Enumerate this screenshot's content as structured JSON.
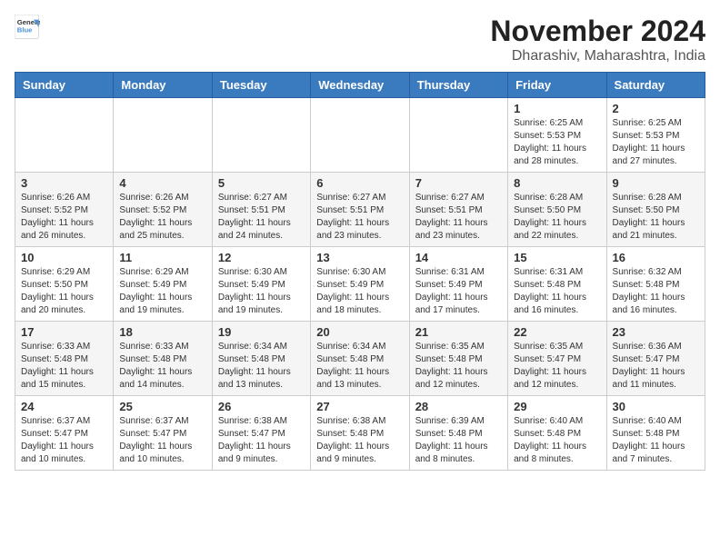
{
  "logo": {
    "line1": "General",
    "line2": "Blue"
  },
  "title": "November 2024",
  "subtitle": "Dharashiv, Maharashtra, India",
  "weekdays": [
    "Sunday",
    "Monday",
    "Tuesday",
    "Wednesday",
    "Thursday",
    "Friday",
    "Saturday"
  ],
  "weeks": [
    [
      {
        "day": "",
        "info": ""
      },
      {
        "day": "",
        "info": ""
      },
      {
        "day": "",
        "info": ""
      },
      {
        "day": "",
        "info": ""
      },
      {
        "day": "",
        "info": ""
      },
      {
        "day": "1",
        "info": "Sunrise: 6:25 AM\nSunset: 5:53 PM\nDaylight: 11 hours and 28 minutes."
      },
      {
        "day": "2",
        "info": "Sunrise: 6:25 AM\nSunset: 5:53 PM\nDaylight: 11 hours and 27 minutes."
      }
    ],
    [
      {
        "day": "3",
        "info": "Sunrise: 6:26 AM\nSunset: 5:52 PM\nDaylight: 11 hours and 26 minutes."
      },
      {
        "day": "4",
        "info": "Sunrise: 6:26 AM\nSunset: 5:52 PM\nDaylight: 11 hours and 25 minutes."
      },
      {
        "day": "5",
        "info": "Sunrise: 6:27 AM\nSunset: 5:51 PM\nDaylight: 11 hours and 24 minutes."
      },
      {
        "day": "6",
        "info": "Sunrise: 6:27 AM\nSunset: 5:51 PM\nDaylight: 11 hours and 23 minutes."
      },
      {
        "day": "7",
        "info": "Sunrise: 6:27 AM\nSunset: 5:51 PM\nDaylight: 11 hours and 23 minutes."
      },
      {
        "day": "8",
        "info": "Sunrise: 6:28 AM\nSunset: 5:50 PM\nDaylight: 11 hours and 22 minutes."
      },
      {
        "day": "9",
        "info": "Sunrise: 6:28 AM\nSunset: 5:50 PM\nDaylight: 11 hours and 21 minutes."
      }
    ],
    [
      {
        "day": "10",
        "info": "Sunrise: 6:29 AM\nSunset: 5:50 PM\nDaylight: 11 hours and 20 minutes."
      },
      {
        "day": "11",
        "info": "Sunrise: 6:29 AM\nSunset: 5:49 PM\nDaylight: 11 hours and 19 minutes."
      },
      {
        "day": "12",
        "info": "Sunrise: 6:30 AM\nSunset: 5:49 PM\nDaylight: 11 hours and 19 minutes."
      },
      {
        "day": "13",
        "info": "Sunrise: 6:30 AM\nSunset: 5:49 PM\nDaylight: 11 hours and 18 minutes."
      },
      {
        "day": "14",
        "info": "Sunrise: 6:31 AM\nSunset: 5:49 PM\nDaylight: 11 hours and 17 minutes."
      },
      {
        "day": "15",
        "info": "Sunrise: 6:31 AM\nSunset: 5:48 PM\nDaylight: 11 hours and 16 minutes."
      },
      {
        "day": "16",
        "info": "Sunrise: 6:32 AM\nSunset: 5:48 PM\nDaylight: 11 hours and 16 minutes."
      }
    ],
    [
      {
        "day": "17",
        "info": "Sunrise: 6:33 AM\nSunset: 5:48 PM\nDaylight: 11 hours and 15 minutes."
      },
      {
        "day": "18",
        "info": "Sunrise: 6:33 AM\nSunset: 5:48 PM\nDaylight: 11 hours and 14 minutes."
      },
      {
        "day": "19",
        "info": "Sunrise: 6:34 AM\nSunset: 5:48 PM\nDaylight: 11 hours and 13 minutes."
      },
      {
        "day": "20",
        "info": "Sunrise: 6:34 AM\nSunset: 5:48 PM\nDaylight: 11 hours and 13 minutes."
      },
      {
        "day": "21",
        "info": "Sunrise: 6:35 AM\nSunset: 5:48 PM\nDaylight: 11 hours and 12 minutes."
      },
      {
        "day": "22",
        "info": "Sunrise: 6:35 AM\nSunset: 5:47 PM\nDaylight: 11 hours and 12 minutes."
      },
      {
        "day": "23",
        "info": "Sunrise: 6:36 AM\nSunset: 5:47 PM\nDaylight: 11 hours and 11 minutes."
      }
    ],
    [
      {
        "day": "24",
        "info": "Sunrise: 6:37 AM\nSunset: 5:47 PM\nDaylight: 11 hours and 10 minutes."
      },
      {
        "day": "25",
        "info": "Sunrise: 6:37 AM\nSunset: 5:47 PM\nDaylight: 11 hours and 10 minutes."
      },
      {
        "day": "26",
        "info": "Sunrise: 6:38 AM\nSunset: 5:47 PM\nDaylight: 11 hours and 9 minutes."
      },
      {
        "day": "27",
        "info": "Sunrise: 6:38 AM\nSunset: 5:48 PM\nDaylight: 11 hours and 9 minutes."
      },
      {
        "day": "28",
        "info": "Sunrise: 6:39 AM\nSunset: 5:48 PM\nDaylight: 11 hours and 8 minutes."
      },
      {
        "day": "29",
        "info": "Sunrise: 6:40 AM\nSunset: 5:48 PM\nDaylight: 11 hours and 8 minutes."
      },
      {
        "day": "30",
        "info": "Sunrise: 6:40 AM\nSunset: 5:48 PM\nDaylight: 11 hours and 7 minutes."
      }
    ]
  ]
}
